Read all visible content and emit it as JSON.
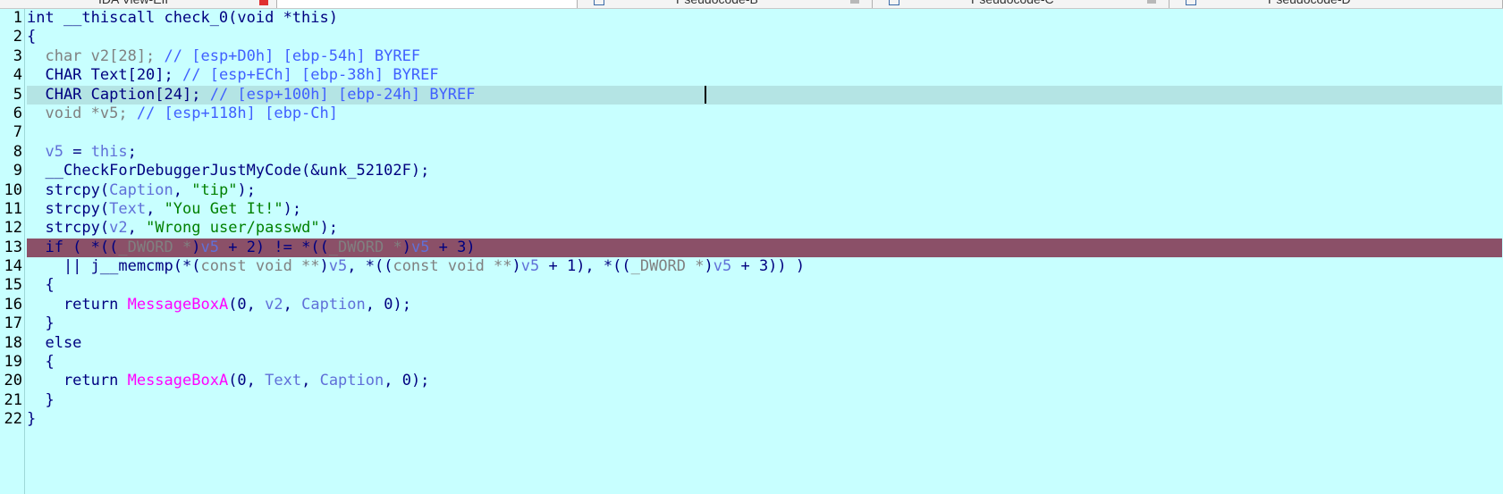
{
  "tabs": [
    {
      "label": "IDA View-EIP",
      "active": false
    },
    {
      "label": "",
      "active": true
    },
    {
      "label": "Pseudocode-B",
      "active": false
    },
    {
      "label": "Pseudocode-C",
      "active": false
    },
    {
      "label": "Pseudocode-D",
      "active": false
    }
  ],
  "lines": [
    {
      "n": "1",
      "parts": [
        [
          "int __thiscall check_0(void *this)",
          "type"
        ]
      ]
    },
    {
      "n": "2",
      "parts": [
        [
          "{",
          "sym"
        ]
      ]
    },
    {
      "n": "3",
      "parts": [
        [
          "  char v2[28]; ",
          "muted"
        ],
        [
          "// [esp+D0h] [ebp-54h] BYREF",
          "cmt"
        ]
      ]
    },
    {
      "n": "4",
      "parts": [
        [
          "  CHAR Text[20]; ",
          "sym"
        ],
        [
          "// [esp+ECh] [ebp-38h] BYREF",
          "cmt"
        ]
      ]
    },
    {
      "n": "5",
      "parts": [
        [
          "  CHAR Caption[24]; ",
          "sym"
        ],
        [
          "// [esp+100h] [ebp-24h] BYREF",
          "cmt"
        ]
      ]
    },
    {
      "n": "6",
      "parts": [
        [
          "  void *v5; ",
          "muted"
        ],
        [
          "// [esp+118h] [ebp-Ch]",
          "cmt"
        ]
      ]
    },
    {
      "n": "7",
      "parts": [
        [
          "",
          "sym"
        ]
      ]
    },
    {
      "n": "8",
      "parts": [
        [
          "  ",
          "sym"
        ],
        [
          "v5",
          "var"
        ],
        [
          " = ",
          "sym"
        ],
        [
          "this",
          "var"
        ],
        [
          ";",
          "sym"
        ]
      ]
    },
    {
      "n": "9",
      "parts": [
        [
          "  __CheckForDebuggerJustMyCode(&unk_52102F);",
          "call"
        ]
      ]
    },
    {
      "n": "10",
      "parts": [
        [
          "  strcpy(",
          "call"
        ],
        [
          "Caption",
          "var"
        ],
        [
          ", ",
          "sym"
        ],
        [
          "\"tip\"",
          "str"
        ],
        [
          ");",
          "sym"
        ]
      ]
    },
    {
      "n": "11",
      "parts": [
        [
          "  strcpy(",
          "call"
        ],
        [
          "Text",
          "var"
        ],
        [
          ", ",
          "sym"
        ],
        [
          "\"You Get It!\"",
          "str"
        ],
        [
          ");",
          "sym"
        ]
      ]
    },
    {
      "n": "12",
      "parts": [
        [
          "  strcpy(",
          "call"
        ],
        [
          "v2",
          "var"
        ],
        [
          ", ",
          "sym"
        ],
        [
          "\"Wrong user/passwd\"",
          "str"
        ],
        [
          ");",
          "sym"
        ]
      ]
    },
    {
      "n": "13",
      "parts": [
        [
          "  if ( *((",
          "sym"
        ],
        [
          "_DWORD *",
          "muted"
        ],
        [
          ")",
          "sym"
        ],
        [
          "v5",
          "var"
        ],
        [
          " + 2) != *((",
          "sym"
        ],
        [
          "_DWORD *",
          "muted"
        ],
        [
          ")",
          "sym"
        ],
        [
          "v5",
          "var"
        ],
        [
          " + 3)",
          "sym"
        ]
      ]
    },
    {
      "n": "14",
      "parts": [
        [
          "    || j__memcmp(*(",
          "call"
        ],
        [
          "const void **",
          "muted"
        ],
        [
          ")",
          "sym"
        ],
        [
          "v5",
          "var"
        ],
        [
          ", *((",
          "sym"
        ],
        [
          "const void **",
          "muted"
        ],
        [
          ")",
          "sym"
        ],
        [
          "v5",
          "var"
        ],
        [
          " + 1), *((",
          "sym"
        ],
        [
          "_DWORD *",
          "muted"
        ],
        [
          ")",
          "sym"
        ],
        [
          "v5",
          "var"
        ],
        [
          " + 3)) )",
          "sym"
        ]
      ]
    },
    {
      "n": "15",
      "parts": [
        [
          "  {",
          "sym"
        ]
      ]
    },
    {
      "n": "16",
      "parts": [
        [
          "    return ",
          "kw"
        ],
        [
          "MessageBoxA",
          "api"
        ],
        [
          "(0, ",
          "sym"
        ],
        [
          "v2",
          "var"
        ],
        [
          ", ",
          "sym"
        ],
        [
          "Caption",
          "var"
        ],
        [
          ", 0);",
          "sym"
        ]
      ]
    },
    {
      "n": "17",
      "parts": [
        [
          "  }",
          "sym"
        ]
      ]
    },
    {
      "n": "18",
      "parts": [
        [
          "  else",
          "kw"
        ]
      ]
    },
    {
      "n": "19",
      "parts": [
        [
          "  {",
          "sym"
        ]
      ]
    },
    {
      "n": "20",
      "parts": [
        [
          "    return ",
          "kw"
        ],
        [
          "MessageBoxA",
          "api"
        ],
        [
          "(0, ",
          "sym"
        ],
        [
          "Text",
          "var"
        ],
        [
          ", ",
          "sym"
        ],
        [
          "Caption",
          "var"
        ],
        [
          ", 0);",
          "sym"
        ]
      ]
    },
    {
      "n": "21",
      "parts": [
        [
          "  }",
          "sym"
        ]
      ]
    },
    {
      "n": "22",
      "parts": [
        [
          "}",
          "sym"
        ]
      ]
    }
  ],
  "highlight": {
    "current_line": "5",
    "breakpoint_line": "13"
  },
  "colors": {
    "background": "#c8ffff",
    "current_line": "#b4e4e4",
    "breakpoint_line": "#8b5068",
    "string": "#008000",
    "api": "#ff00ff",
    "variable": "#6070d8",
    "comment": "#4060ff"
  }
}
